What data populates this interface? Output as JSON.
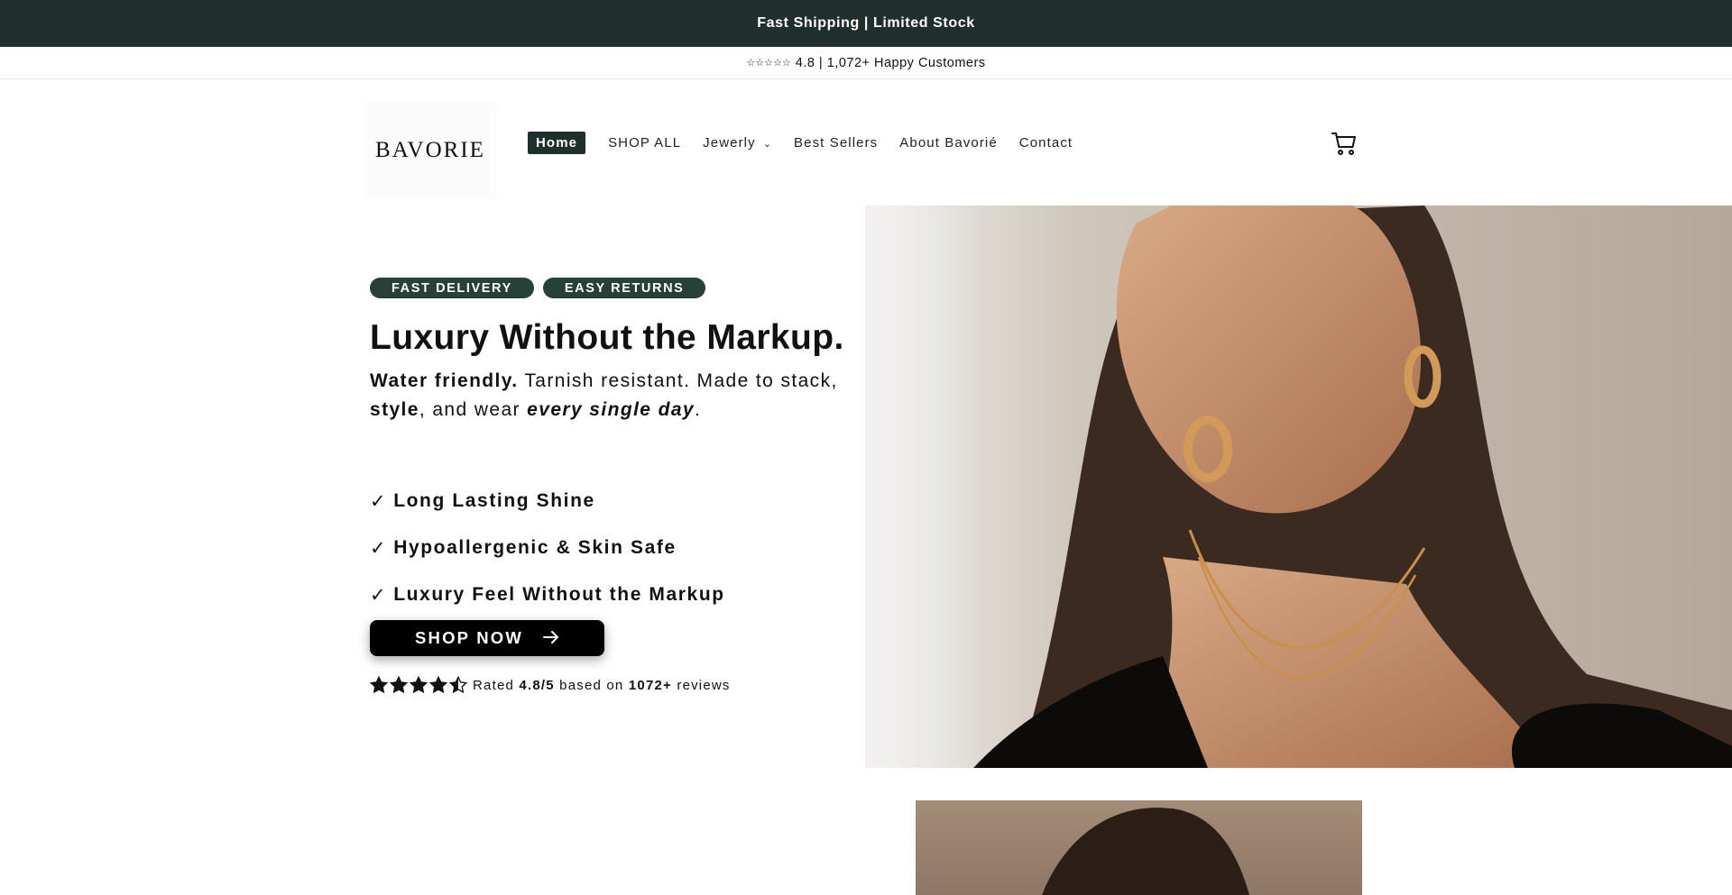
{
  "announcement": "Fast Shipping | Limited Stock",
  "subbar": {
    "stars": "☆☆☆☆☆",
    "text": "4.8 | 1,072+ Happy Customers"
  },
  "header": {
    "logo": "BAVORIE",
    "nav": [
      {
        "label": "Home",
        "active": true
      },
      {
        "label": "SHOP ALL"
      },
      {
        "label": "Jewerly",
        "has_dropdown": true
      },
      {
        "label": "Best Sellers"
      },
      {
        "label": "About Bavorié"
      },
      {
        "label": "Contact"
      }
    ],
    "cart_icon": "cart-icon"
  },
  "hero": {
    "badges": [
      "FAST DELIVERY",
      "EASY RETURNS"
    ],
    "headline": "Luxury Without the Markup.",
    "subhead": {
      "part1_bold": "Water friendly.",
      "part2": " Tarnish resistant. Made to stack,",
      "part3_bold": "style",
      "part4": ", and wear ",
      "part5_bold_italic": "every single day",
      "part6": "."
    },
    "features": [
      "Long Lasting Shine",
      "Hypoallergenic & Skin Safe",
      "Luxury Feel Without the Markup"
    ],
    "check_symbol": "✓",
    "cta": "SHOP NOW",
    "rating": {
      "stars_value": 4.5,
      "prefix": "Rated ",
      "score": "4.8/5",
      "middle": " based on ",
      "count": "1072+",
      "suffix": " reviews"
    }
  },
  "colors": {
    "dark_green": "#1f2f2b",
    "badge_green": "#26403a",
    "black": "#000000"
  }
}
